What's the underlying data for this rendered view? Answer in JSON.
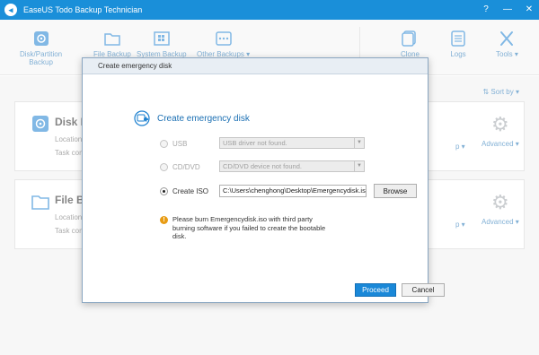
{
  "window": {
    "title": "EaseUS Todo Backup Technician",
    "controls": {
      "help": "?",
      "minimize": "—",
      "close": "✕"
    }
  },
  "toolbar": {
    "disk_partition_backup": [
      "Disk/Partition",
      "Backup"
    ],
    "file_backup": "File Backup",
    "system_backup": "System Backup",
    "other_backups": "Other Backups ▾",
    "clone": "Clone",
    "logs": "Logs",
    "tools": "Tools ▾"
  },
  "content": {
    "sort_by": "⇅ Sort by ▾",
    "cards": [
      {
        "name": "Disk Bac",
        "line1": "Location:",
        "line2": "Task com",
        "partial": "p ▾",
        "advanced": "Advanced ▾"
      },
      {
        "name": "File Ba",
        "line1": "Location:",
        "line2": "Task com",
        "partial": "p ▾",
        "advanced": "Advanced ▾"
      }
    ]
  },
  "dialog": {
    "title": "Create emergency disk",
    "heading": "Create emergency disk",
    "usb": {
      "label": "USB",
      "combo": "USB driver not found.",
      "selected": false,
      "enabled": false
    },
    "cddvd": {
      "label": "CD/DVD",
      "combo": "CD/DVD device not found.",
      "selected": false,
      "enabled": false
    },
    "iso": {
      "label": "Create ISO",
      "path": "C:\\Users\\chenghong\\Desktop\\Emergencydisk.iso",
      "selected": true
    },
    "browse_label": "Browse",
    "info_text": "Please burn Emergencydisk.iso with third party burning software if you failed to create the bootable disk.",
    "proceed_label": "Proceed",
    "cancel_label": "Cancel"
  },
  "colors": {
    "titlebar": "#1a8fd9",
    "accent": "#1a6fb3",
    "primary_button": "#1a88d8",
    "info_icon": "#e89c14"
  }
}
